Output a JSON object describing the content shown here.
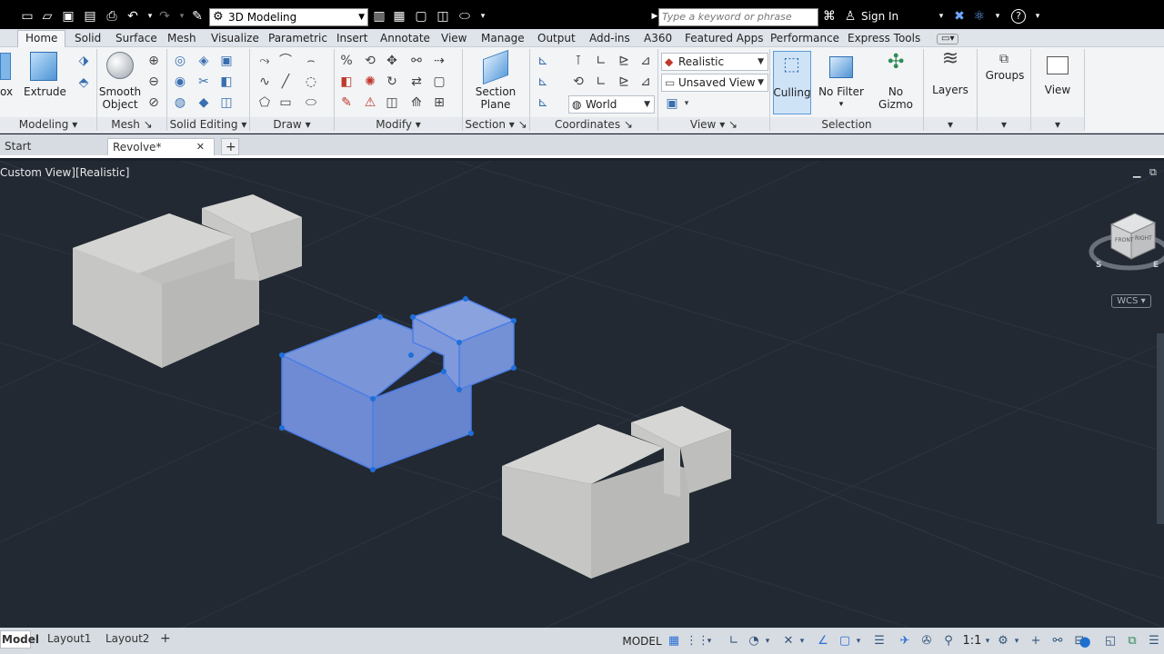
{
  "quick_access": {
    "workspace": "3D Modeling",
    "search_placeholder": "Type a keyword or phrase",
    "sign_in": "Sign In"
  },
  "ribbon_tabs": [
    "Home",
    "Solid",
    "Surface",
    "Mesh",
    "Visualize",
    "Parametric",
    "Insert",
    "Annotate",
    "View",
    "Manage",
    "Output",
    "Add-ins",
    "A360",
    "Featured Apps",
    "Performance",
    "Express Tools"
  ],
  "ribbon": {
    "modeling": {
      "title": "Modeling",
      "box_label": "ox",
      "extrude_label": "Extrude"
    },
    "mesh": {
      "title": "Mesh",
      "smooth_line1": "Smooth",
      "smooth_line2": "Object"
    },
    "solid_editing": {
      "title": "Solid Editing"
    },
    "draw": {
      "title": "Draw"
    },
    "modify": {
      "title": "Modify"
    },
    "section": {
      "title": "Section",
      "plane_line1": "Section",
      "plane_line2": "Plane"
    },
    "coordinates": {
      "title": "Coordinates",
      "ucs_value": "World"
    },
    "view": {
      "title": "View",
      "visual_style": "Realistic",
      "named_view": "Unsaved View"
    },
    "selection": {
      "title": "Selection",
      "culling": "Culling",
      "no_filter": "No Filter",
      "gizmo_line1": "No",
      "gizmo_line2": "Gizmo"
    },
    "layers": {
      "label": "Layers"
    },
    "groups": {
      "label": "Groups"
    },
    "view_panel": {
      "label": "View"
    }
  },
  "doc_tabs": {
    "start": "Start",
    "active": "Revolve*"
  },
  "viewport": {
    "label": "Custom View][Realistic]",
    "wcs": "WCS",
    "cube_front": "FRONT",
    "cube_right": "RIGHT",
    "compass_s": "S",
    "compass_e": "E"
  },
  "layout_tabs": [
    "Model",
    "Layout1",
    "Layout2"
  ],
  "status": {
    "model": "MODEL",
    "scale": "1:1"
  },
  "colors": {
    "viewport_bg": "#222933",
    "solid_gray": "#c4c5c2",
    "selection_blue": "#6d8ee0",
    "grip_blue": "#1e6fd9"
  }
}
